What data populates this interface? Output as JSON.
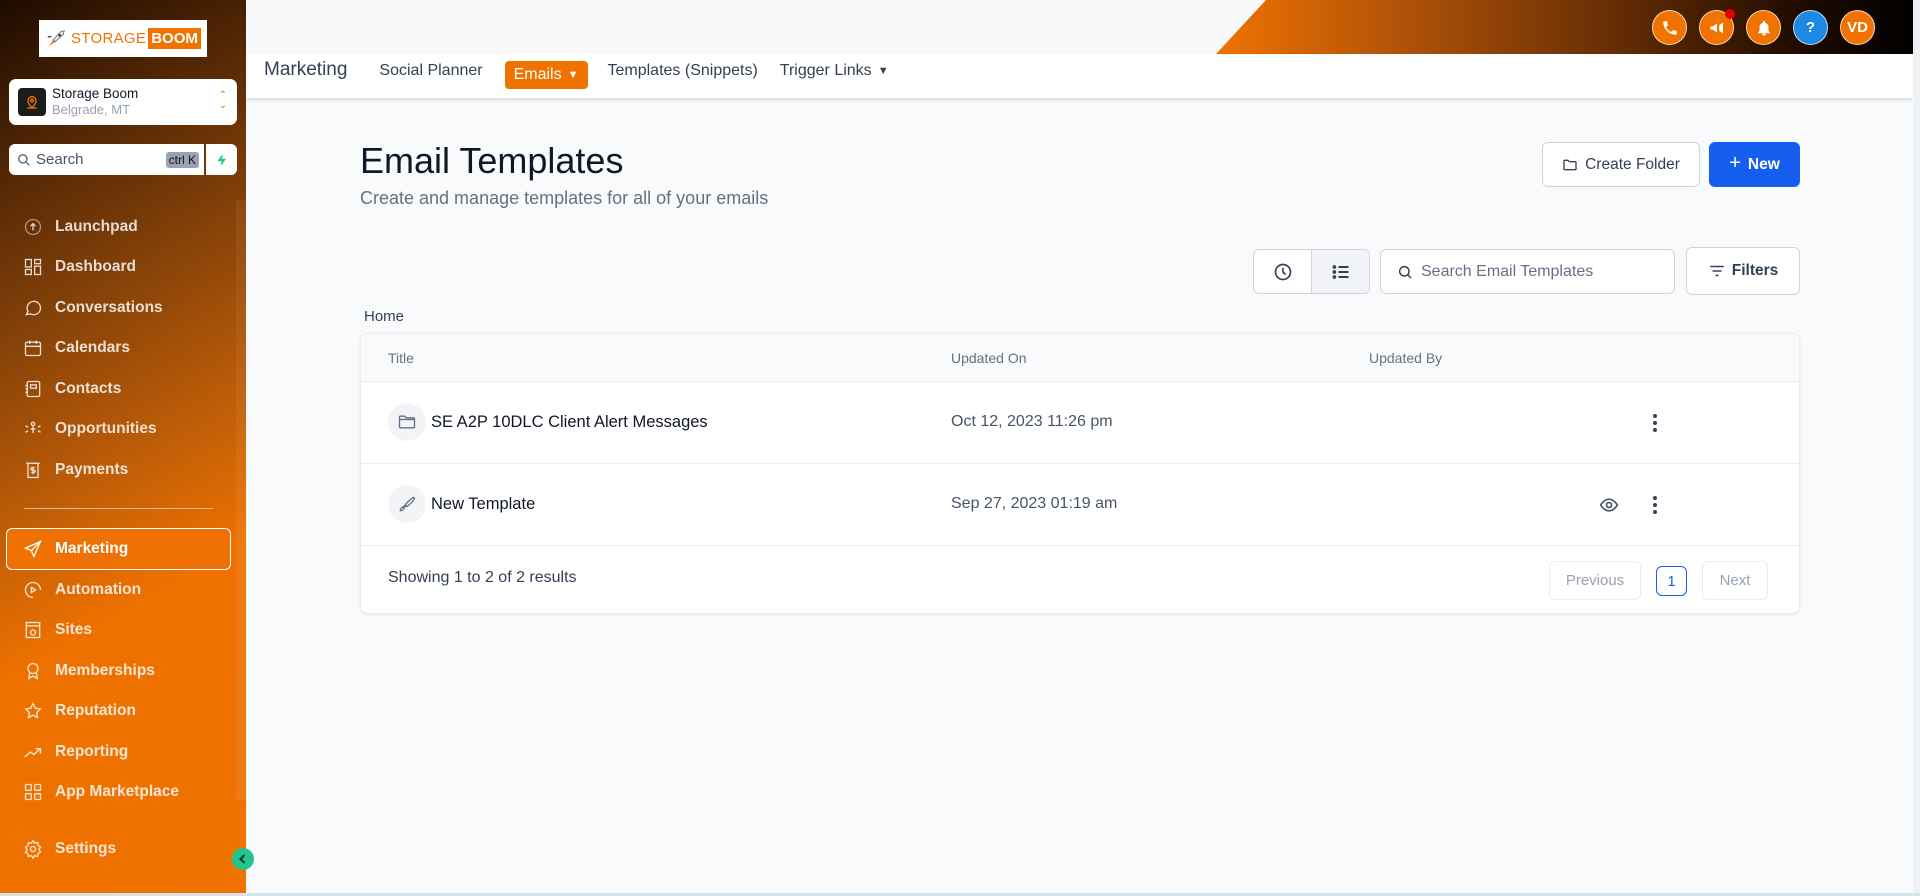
{
  "brand": {
    "logo_text_light": "STORAGE",
    "logo_text_bold": "BOOM",
    "accent_color": "#f07300",
    "primary_color": "#155eef"
  },
  "location": {
    "name": "Storage Boom",
    "address": "Belgrade, MT"
  },
  "sidebar_search": {
    "placeholder": "Search",
    "shortcut": "ctrl K"
  },
  "sidebar": {
    "items": [
      {
        "label": "Launchpad",
        "icon": "launchpad-icon"
      },
      {
        "label": "Dashboard",
        "icon": "dashboard-icon"
      },
      {
        "label": "Conversations",
        "icon": "chat-bubble-icon"
      },
      {
        "label": "Calendars",
        "icon": "calendar-icon"
      },
      {
        "label": "Contacts",
        "icon": "contacts-book-icon"
      },
      {
        "label": "Opportunities",
        "icon": "opportunities-icon"
      },
      {
        "label": "Payments",
        "icon": "payments-icon"
      },
      {
        "label": "Marketing",
        "icon": "send-icon",
        "active": true
      },
      {
        "label": "Automation",
        "icon": "automation-play-icon"
      },
      {
        "label": "Sites",
        "icon": "sites-icon"
      },
      {
        "label": "Memberships",
        "icon": "badge-icon"
      },
      {
        "label": "Reputation",
        "icon": "star-icon"
      },
      {
        "label": "Reporting",
        "icon": "trend-icon"
      },
      {
        "label": "App Marketplace",
        "icon": "apps-grid-icon"
      },
      {
        "label": "Settings",
        "icon": "gear-icon"
      }
    ]
  },
  "header": {
    "avatar_initials": "VD",
    "icons": [
      "phone-icon",
      "megaphone-icon",
      "bell-icon",
      "help-icon",
      "avatar"
    ]
  },
  "subnav": {
    "title": "Marketing",
    "tabs": [
      {
        "label": "Social Planner"
      },
      {
        "label": "Emails",
        "active": true,
        "dropdown": true
      },
      {
        "label": "Templates (Snippets)"
      },
      {
        "label": "Trigger Links",
        "dropdown": true
      }
    ]
  },
  "page": {
    "title": "Email Templates",
    "subtitle": "Create and manage templates for all of your emails",
    "create_folder_label": "Create Folder",
    "new_label": "New",
    "search_placeholder": "Search Email Templates",
    "filters_label": "Filters",
    "breadcrumb": "Home"
  },
  "table": {
    "columns": [
      "Title",
      "Updated On",
      "Updated By"
    ],
    "rows": [
      {
        "type": "folder",
        "title": "SE A2P 10DLC Client Alert Messages",
        "updated_on": "Oct 12, 2023 11:26 pm",
        "updated_by": "",
        "preview": false
      },
      {
        "type": "template",
        "title": "New Template",
        "updated_on": "Sep 27, 2023 01:19 am",
        "updated_by": "",
        "preview": true
      }
    ],
    "footer": "Showing 1 to 2 of 2 results",
    "pagination": {
      "previous": "Previous",
      "current": "1",
      "next": "Next"
    }
  }
}
